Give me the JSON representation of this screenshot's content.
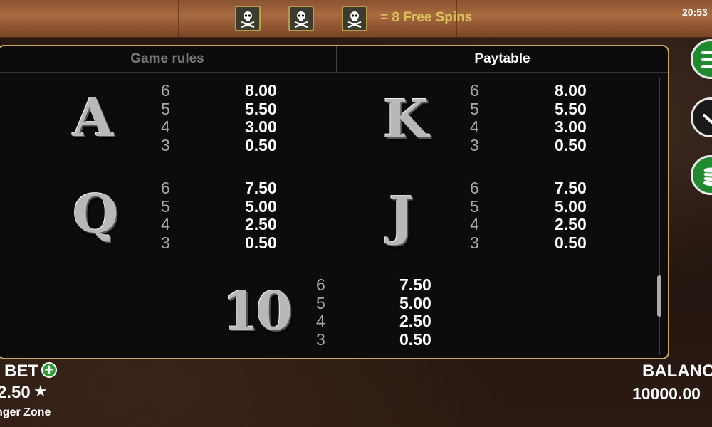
{
  "header": {
    "free_spins_text": "= 8 Free Spins",
    "scatter_icon": "skull-crossbones-icon",
    "clock": "20:53"
  },
  "tabs": [
    {
      "label": "Game rules",
      "active": false
    },
    {
      "label": "Paytable",
      "active": true
    }
  ],
  "paytable": [
    {
      "symbol": "A",
      "counts": [
        "6",
        "5",
        "4",
        "3"
      ],
      "payouts": [
        "8.00",
        "5.50",
        "3.00",
        "0.50"
      ]
    },
    {
      "symbol": "K",
      "counts": [
        "6",
        "5",
        "4",
        "3"
      ],
      "payouts": [
        "8.00",
        "5.50",
        "3.00",
        "0.50"
      ]
    },
    {
      "symbol": "Q",
      "counts": [
        "6",
        "5",
        "4",
        "3"
      ],
      "payouts": [
        "7.50",
        "5.00",
        "2.50",
        "0.50"
      ]
    },
    {
      "symbol": "J",
      "counts": [
        "6",
        "5",
        "4",
        "3"
      ],
      "payouts": [
        "7.50",
        "5.00",
        "2.50",
        "0.50"
      ]
    },
    {
      "symbol": "10",
      "counts": [
        "6",
        "5",
        "4",
        "3"
      ],
      "payouts": [
        "7.50",
        "5.00",
        "2.50",
        "0.50"
      ]
    }
  ],
  "bottom": {
    "bet_label": "BET",
    "bet_value": "2.50",
    "zone_label": "nger Zone",
    "balance_label": "BALANC",
    "balance_value": "10000.00"
  },
  "colors": {
    "panel_border": "#c7a85a",
    "accent_green": "#1f8a2e",
    "free_spins_text": "#d9c35a"
  }
}
